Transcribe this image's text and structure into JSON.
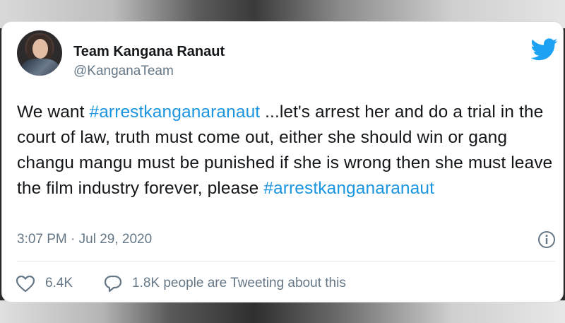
{
  "tweet": {
    "author_name": "Team Kangana Ranaut",
    "author_handle": "@KanganaTeam",
    "text_1": "We want ",
    "hashtag_1": "#arrestkanganaranaut",
    "text_2": " ...let's arrest her and do a trial in the court of law, truth must come out, either she should win or gang changu mangu must be punished if she is wrong then she must leave the film industry forever, please ",
    "hashtag_2": "#arrestkanganaranaut",
    "timestamp": "3:07 PM · Jul 29, 2020",
    "likes": "6.4K",
    "people_tweeting": "1.8K people are Tweeting about this"
  },
  "icons": {
    "brand": "twitter-bird-icon",
    "info": "info-icon",
    "like": "heart-icon",
    "reply": "speech-bubble-icon"
  },
  "colors": {
    "link": "#1b95e0",
    "brand": "#1da1f2",
    "muted": "#657786",
    "text": "#14171a"
  }
}
